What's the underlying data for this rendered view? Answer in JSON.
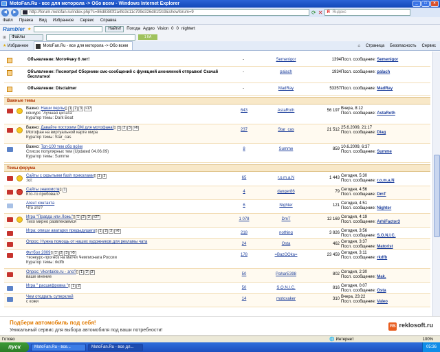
{
  "window": {
    "title": "MotoFan.Ru - все для моторола -> Обо всем - Windows Internet Explorer",
    "url": "http://forum.motofan.ru/index.php?s=86d8380f2a4fe3c11c799e326d81f2c9&showforum=9",
    "search_placeholder": "Яндекс"
  },
  "menu": [
    "Файл",
    "Правка",
    "Вид",
    "Избранное",
    "Сервис",
    "Справка"
  ],
  "toolbar": {
    "brand": "Rambler",
    "find_label": "Найти!",
    "files_label": "Файлы",
    "items": [
      "Погода",
      "Аудио",
      "Vision",
      "0",
      "0",
      "nightert"
    ],
    "widget": "1 КА"
  },
  "tabs": {
    "favorites": "Избранное",
    "active_tab": "MotoFan.Ru - все для моторола -> Обо всем",
    "commands": [
      "Страница",
      "Безопасность",
      "Сервис"
    ]
  },
  "announcements": [
    {
      "title": "Объявление: МотоФану 6 лет!",
      "replies": "-",
      "author": "Semenigor",
      "views": "1394",
      "last_label": "Посл. сообщение:",
      "last_user": "Semenigor"
    },
    {
      "title": "Объявление: Посмотри! Сборники смс-сообщений с функцией анонимной отправки! Скачай бесплатно!",
      "replies": "-",
      "author": "palach",
      "views": "1934",
      "last_label": "Посл. сообщение:",
      "last_user": "palach"
    },
    {
      "title": "Объявление: Disclaimer",
      "replies": "-",
      "author": "MadRay",
      "views": "53357",
      "last_label": "Посл. сообщение:",
      "last_user": "MadRay"
    }
  ],
  "sections": {
    "important": "Важные темы",
    "forum": "Темы форума"
  },
  "important_topics": [
    {
      "prefix": "Важно: ",
      "title": "Наши перлы",
      "pages": [
        "1",
        "2",
        "3",
        "»17"
      ],
      "sub": "конкурс \"лучшая цитата\"",
      "curator": "Куратор темы: Dark Beat",
      "replies": "643",
      "author": "AstaRoth",
      "views": "56 197",
      "date": "Вчера, 8:12",
      "last_label": "Посл. сообщение:",
      "last_user": "AstaRoth"
    },
    {
      "prefix": "Важно: ",
      "title": "Давайте построим DM для мотофана!",
      "pages": [
        "1",
        "2",
        "3",
        "»6"
      ],
      "sub": "Мотофан на виртуальной карте мира",
      "curator": "Куратор темы: Star_cas",
      "replies": "237",
      "author": "Star_cas",
      "views": "21 512",
      "date": "25.6.2009, 21:17",
      "last_label": "Посл. сообщение:",
      "last_user": "Diag"
    },
    {
      "prefix": "Важно: ",
      "title": "Топ-100 тем обо всём",
      "pages": [],
      "sub": "Список популярных тем (Updated 04.06.09)",
      "curator": "Куратор темы: Summe",
      "replies": "8",
      "author": "Summe",
      "views": "859",
      "date": "10.6.2009, 6:37",
      "last_label": "Посл. сообщение:",
      "last_user": "Summe"
    }
  ],
  "forum_topics": [
    {
      "title": "Сайты с скрытыми flash приколами",
      "pages": [
        "1",
        "2"
      ],
      "sub": ":lol:",
      "replies": "65",
      "author": "r.o.m.a.N",
      "views": "1 443",
      "date": "Сегодня, 5:30",
      "last_label": "Посл. сообщение:",
      "last_user": "r.o.m.a.N"
    },
    {
      "title": "Сайты знакомств",
      "pages": [
        "1"
      ],
      "sub": "Кто-то пробовал?",
      "replies": "4",
      "author": "danger86",
      "views": "79",
      "date": "Сегодня, 4:56",
      "last_label": "Посл. сообщение:",
      "last_user": "DmT"
    },
    {
      "title": "Агент контакта",
      "pages": [],
      "sub": "Что это?",
      "replies": "6",
      "author": "Nighter",
      "views": "121",
      "date": "Сегодня, 4:51",
      "last_label": "Посл. сообщение:",
      "last_user": "Nighter"
    },
    {
      "title": "Игра \"Правда или Ложь\"",
      "pages": [
        "1",
        "2",
        "3",
        "»27"
      ],
      "sub": "Тихо мирно развлекаемся",
      "replies": "1 078",
      "author": "DmT",
      "views": "12 169",
      "date": "Сегодня, 4:19",
      "last_label": "Посл. сообщение:",
      "last_user": "ArhiFactor3"
    },
    {
      "title": "Игра: опиши аватарку предыдущего",
      "pages": [
        "1",
        "2",
        "3",
        "»6"
      ],
      "sub": "",
      "replies": "218",
      "author": "nothing",
      "views": "3 826",
      "date": "Сегодня, 3:56",
      "last_label": "Посл. сообщение:",
      "last_user": "S.O.N.I.C."
    },
    {
      "title": "Опрос: Нужна помощь от наших художников для рекламы чата",
      "pages": [],
      "sub": "",
      "replies": "24",
      "author": "Osta",
      "views": "462",
      "date": "Сегодня, 3:37",
      "last_label": "Посл. сообщение:",
      "last_user": "Matorist"
    },
    {
      "title": "Футбол 2009",
      "pages": [
        "1",
        "2",
        "3",
        "»5"
      ],
      "sub": "+конкурс-прогноз на матчи Чемпионата России",
      "curator": "Куратор темы: rkdfb",
      "replies": "178",
      "author": "=BazOOka=",
      "views": "23 459",
      "date": "Сегодня, 3:11",
      "last_label": "Посл. сообщение:",
      "last_user": "rkdfb"
    },
    {
      "title": "Опрос: Vkontakte.ru - зло?",
      "pages": [
        "1",
        "2",
        "3"
      ],
      "sub": "ваше мнение",
      "replies": "50",
      "author": "PaharE398",
      "views": "802",
      "date": "Сегодня, 2:30",
      "last_label": "Посл. сообщение:",
      "last_user": "Mak."
    },
    {
      "title": "Игра \" расшифровка \"",
      "pages": [
        "1",
        "2"
      ],
      "sub": "",
      "replies": "50",
      "author": "S.O.N.I.C.",
      "views": "816",
      "date": "Сегодня, 0:07",
      "last_label": "Посл. сообщение:",
      "last_user": "Osta"
    },
    {
      "title": "Чем отодрать суперклей",
      "pages": [],
      "sub": "с кожи",
      "replies": "14",
      "author": "motoxaker",
      "views": "310",
      "date": "Вчера, 23:22",
      "last_label": "Посл. сообщение:",
      "last_user": "Valeo"
    }
  ],
  "ad": {
    "headline": "Подбери автомобиль под себя!",
    "text": "Уникальный сервис для выбора автомобиля под ваши потребности!",
    "brand": "reklosoft.ru",
    "brand_icon": "RS"
  },
  "status": {
    "left": "Готово",
    "zone": "Интернет",
    "zoom": "100%"
  },
  "taskbar": {
    "start": "пуск",
    "tasks": [
      "MotoFan.Ru - все...",
      "MotoFan.Ru - все дл..."
    ],
    "clock": "05:36"
  }
}
